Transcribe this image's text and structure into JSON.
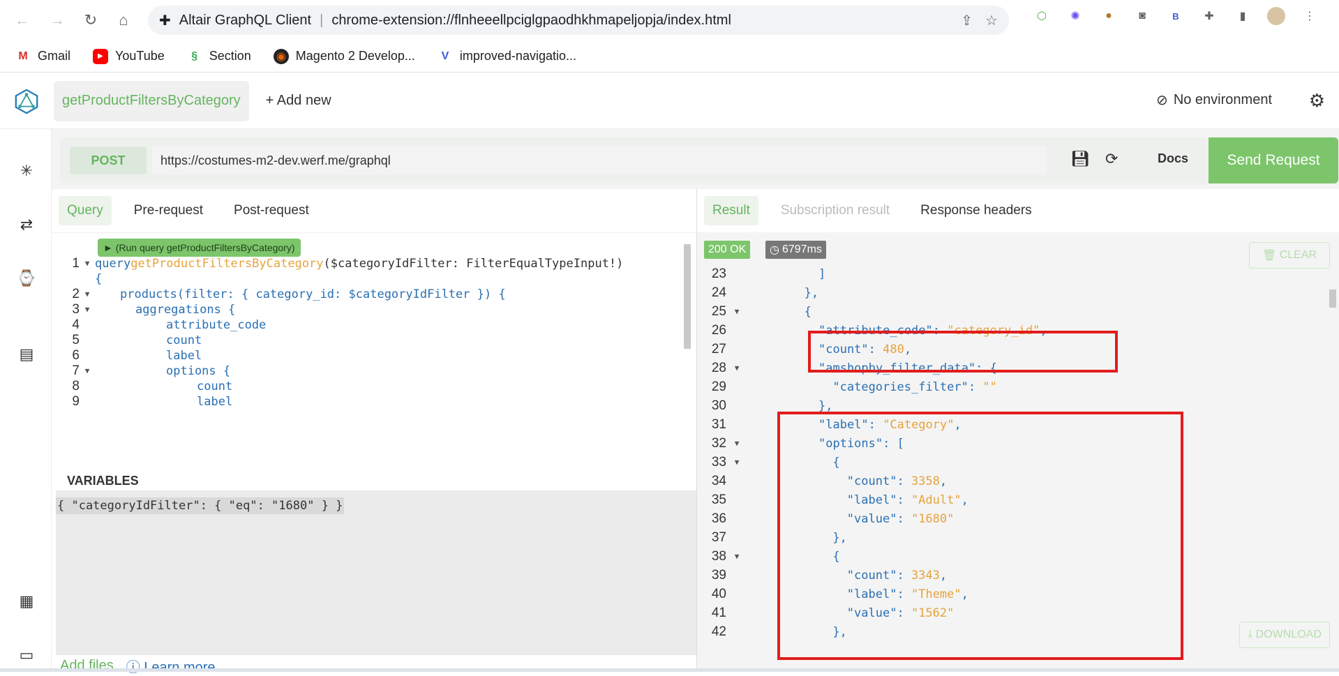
{
  "browser": {
    "app_title": "Altair GraphQL Client",
    "url": "chrome-extension://flnheeellpciglgpaodhkhmapeljopja/index.html",
    "bookmarks": [
      {
        "label": "Gmail",
        "icon": "gmail-icon",
        "color": "#d93025"
      },
      {
        "label": "YouTube",
        "icon": "youtube-icon",
        "color": "#ff0000"
      },
      {
        "label": "Section",
        "icon": "section-icon",
        "color": "#34a853"
      },
      {
        "label": "Magento 2 Develop...",
        "icon": "magento-icon",
        "color": "#e8620a"
      },
      {
        "label": "improved-navigatio...",
        "icon": "vercel-icon",
        "color": "#3b5bdb"
      }
    ]
  },
  "header": {
    "window_tab": "getProductFiltersByCategory",
    "add_new": "+ Add new",
    "environment": "No environment"
  },
  "request": {
    "method": "POST",
    "url": "https://costumes-m2-dev.werf.me/graphql",
    "docs": "Docs",
    "send": "Send Request"
  },
  "left_tabs": [
    "Query",
    "Pre-request",
    "Post-request"
  ],
  "run_hint": "► (Run query getProductFiltersByCategory)",
  "query_lines": [
    {
      "n": "1",
      "fold": "▼"
    },
    {
      "n": "",
      "fold": ""
    },
    {
      "n": "2",
      "fold": "▼"
    },
    {
      "n": "3",
      "fold": "▼"
    },
    {
      "n": "4",
      "fold": ""
    },
    {
      "n": "5",
      "fold": ""
    },
    {
      "n": "6",
      "fold": ""
    },
    {
      "n": "7",
      "fold": "▼"
    },
    {
      "n": "8",
      "fold": ""
    },
    {
      "n": "9",
      "fold": ""
    }
  ],
  "query_text": {
    "l1_kw": "query",
    "l1_fn": "getProductFiltersByCategory",
    "l1_args": "($categoryIdFilter: FilterEqualTypeInput!)",
    "l1b": "{",
    "l2": "products(filter: { category_id: $categoryIdFilter }) {",
    "l3": "aggregations {",
    "l4": "attribute_code",
    "l5": "count",
    "l6": "label",
    "l7": "options {",
    "l8": "count",
    "l9": "label"
  },
  "variables_label": "VARIABLES",
  "variables_text": "{ \"categoryIdFilter\": { \"eq\": \"1680\" } }",
  "bottom_links": {
    "add_files": "Add files",
    "learn_more": "Learn more"
  },
  "right_tabs": [
    "Result",
    "Subscription result",
    "Response headers"
  ],
  "status": {
    "code": "200 OK",
    "time": "6797ms"
  },
  "result_actions": {
    "clear": "CLEAR",
    "download": "DOWNLOAD"
  },
  "result_lines": [
    {
      "n": "23",
      "fold": "",
      "indent": 10,
      "parts": [
        [
          "punct",
          "]"
        ]
      ]
    },
    {
      "n": "24",
      "fold": "",
      "indent": 8,
      "parts": [
        [
          "punct",
          "},"
        ]
      ]
    },
    {
      "n": "25",
      "fold": "▼",
      "indent": 8,
      "parts": [
        [
          "punct",
          "{"
        ]
      ]
    },
    {
      "n": "26",
      "fold": "",
      "indent": 10,
      "parts": [
        [
          "key",
          "\"attribute_code\""
        ],
        [
          "punct",
          ": "
        ],
        [
          "sval",
          "\"category_id\""
        ],
        [
          "punct",
          ","
        ]
      ]
    },
    {
      "n": "27",
      "fold": "",
      "indent": 10,
      "parts": [
        [
          "key",
          "\"count\""
        ],
        [
          "punct",
          ": "
        ],
        [
          "nval",
          "480"
        ],
        [
          "punct",
          ","
        ]
      ]
    },
    {
      "n": "28",
      "fold": "▼",
      "indent": 10,
      "parts": [
        [
          "key",
          "\"amshopby_filter_data\""
        ],
        [
          "punct",
          ": {"
        ]
      ]
    },
    {
      "n": "29",
      "fold": "",
      "indent": 12,
      "parts": [
        [
          "key",
          "\"categories_filter\""
        ],
        [
          "punct",
          ": "
        ],
        [
          "sval",
          "\"\""
        ]
      ]
    },
    {
      "n": "30",
      "fold": "",
      "indent": 10,
      "parts": [
        [
          "punct",
          "},"
        ]
      ]
    },
    {
      "n": "31",
      "fold": "",
      "indent": 10,
      "parts": [
        [
          "key",
          "\"label\""
        ],
        [
          "punct",
          ": "
        ],
        [
          "sval",
          "\"Category\""
        ],
        [
          "punct",
          ","
        ]
      ]
    },
    {
      "n": "32",
      "fold": "▼",
      "indent": 10,
      "parts": [
        [
          "key",
          "\"options\""
        ],
        [
          "punct",
          ": ["
        ]
      ]
    },
    {
      "n": "33",
      "fold": "▼",
      "indent": 12,
      "parts": [
        [
          "punct",
          "{"
        ]
      ]
    },
    {
      "n": "34",
      "fold": "",
      "indent": 14,
      "parts": [
        [
          "key",
          "\"count\""
        ],
        [
          "punct",
          ": "
        ],
        [
          "nval",
          "3358"
        ],
        [
          "punct",
          ","
        ]
      ]
    },
    {
      "n": "35",
      "fold": "",
      "indent": 14,
      "parts": [
        [
          "key",
          "\"label\""
        ],
        [
          "punct",
          ": "
        ],
        [
          "sval",
          "\"Adult\""
        ],
        [
          "punct",
          ","
        ]
      ]
    },
    {
      "n": "36",
      "fold": "",
      "indent": 14,
      "parts": [
        [
          "key",
          "\"value\""
        ],
        [
          "punct",
          ": "
        ],
        [
          "sval",
          "\"1680\""
        ]
      ]
    },
    {
      "n": "37",
      "fold": "",
      "indent": 12,
      "parts": [
        [
          "punct",
          "},"
        ]
      ]
    },
    {
      "n": "38",
      "fold": "▼",
      "indent": 12,
      "parts": [
        [
          "punct",
          "{"
        ]
      ]
    },
    {
      "n": "39",
      "fold": "",
      "indent": 14,
      "parts": [
        [
          "key",
          "\"count\""
        ],
        [
          "punct",
          ": "
        ],
        [
          "nval",
          "3343"
        ],
        [
          "punct",
          ","
        ]
      ]
    },
    {
      "n": "40",
      "fold": "",
      "indent": 14,
      "parts": [
        [
          "key",
          "\"label\""
        ],
        [
          "punct",
          ": "
        ],
        [
          "sval",
          "\"Theme\""
        ],
        [
          "punct",
          ","
        ]
      ]
    },
    {
      "n": "41",
      "fold": "",
      "indent": 14,
      "parts": [
        [
          "key",
          "\"value\""
        ],
        [
          "punct",
          ": "
        ],
        [
          "sval",
          "\"1562\""
        ]
      ]
    },
    {
      "n": "42",
      "fold": "",
      "indent": 12,
      "parts": [
        [
          "punct",
          "},"
        ]
      ]
    }
  ]
}
